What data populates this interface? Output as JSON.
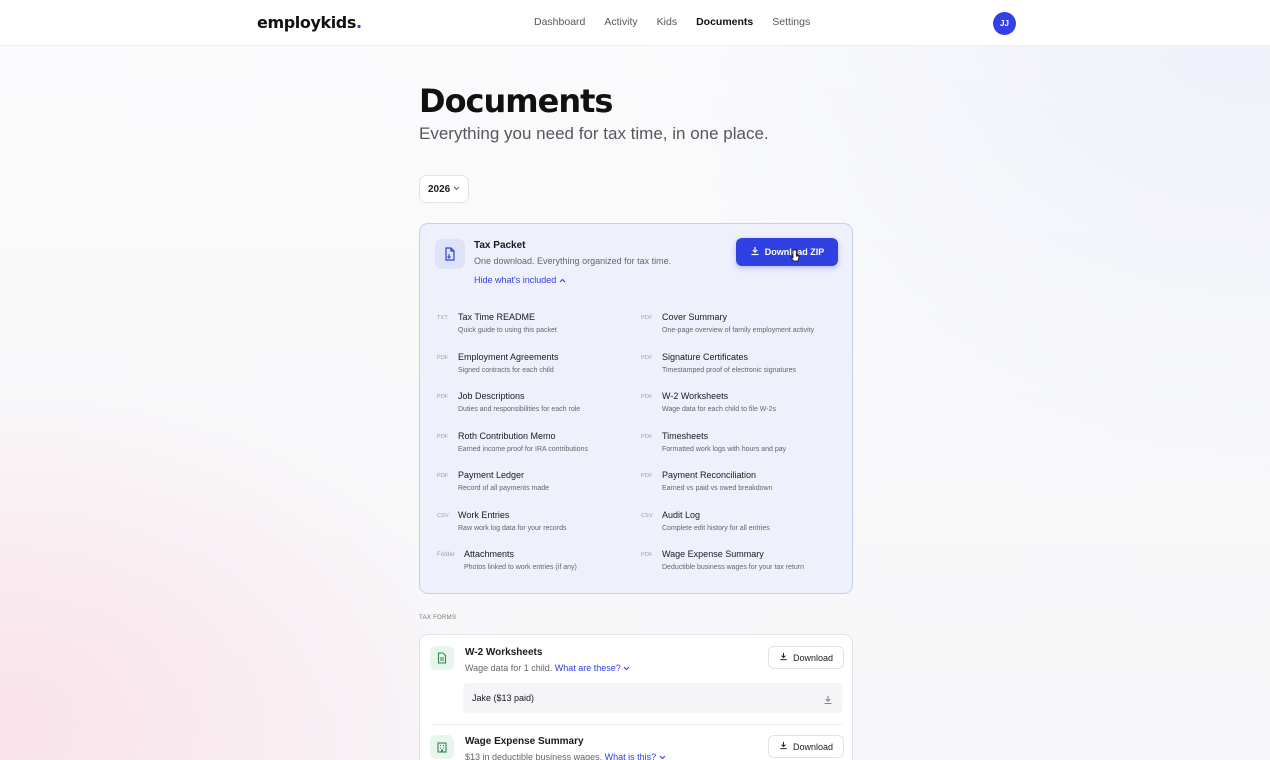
{
  "brand": {
    "name": "employkids",
    "dot": "."
  },
  "nav": {
    "items": [
      "Dashboard",
      "Activity",
      "Kids",
      "Documents",
      "Settings"
    ],
    "active": "Documents"
  },
  "user": {
    "initials": "JJ"
  },
  "page": {
    "title": "Documents",
    "subtitle": "Everything you need for tax time, in one place."
  },
  "year_select": {
    "value": "2026"
  },
  "packet": {
    "title": "Tax Packet",
    "description": "One download. Everything organized for tax time.",
    "toggle_label": "Hide what's included",
    "download_label": "Download ZIP",
    "files": [
      {
        "ext": "TXT",
        "name": "Tax Time README",
        "desc": "Quick guide to using this packet"
      },
      {
        "ext": "PDF",
        "name": "Cover Summary",
        "desc": "One-page overview of family employment activity"
      },
      {
        "ext": "PDF",
        "name": "Employment Agreements",
        "desc": "Signed contracts for each child"
      },
      {
        "ext": "PDF",
        "name": "Signature Certificates",
        "desc": "Timestamped proof of electronic signatures"
      },
      {
        "ext": "PDF",
        "name": "Job Descriptions",
        "desc": "Duties and responsibilities for each role"
      },
      {
        "ext": "PDF",
        "name": "W-2 Worksheets",
        "desc": "Wage data for each child to file W-2s"
      },
      {
        "ext": "PDF",
        "name": "Roth Contribution Memo",
        "desc": "Earned income proof for IRA contributions"
      },
      {
        "ext": "PDF",
        "name": "Timesheets",
        "desc": "Formatted work logs with hours and pay"
      },
      {
        "ext": "PDF",
        "name": "Payment Ledger",
        "desc": "Record of all payments made"
      },
      {
        "ext": "PDF",
        "name": "Payment Reconciliation",
        "desc": "Earned vs paid vs owed breakdown"
      },
      {
        "ext": "CSV",
        "name": "Work Entries",
        "desc": "Raw work log data for your records"
      },
      {
        "ext": "CSV",
        "name": "Audit Log",
        "desc": "Complete edit history for all entries"
      },
      {
        "ext": "Folder",
        "name": "Attachments",
        "desc": "Photos linked to work entries (if any)"
      },
      {
        "ext": "PDF",
        "name": "Wage Expense Summary",
        "desc": "Deductible business wages for your tax return"
      }
    ]
  },
  "tax_forms": {
    "section_label": "TAX FORMS",
    "w2": {
      "title": "W-2 Worksheets",
      "desc": "Wage data for 1 child.",
      "link": "What are these?",
      "download_label": "Download",
      "children": [
        {
          "label": "Jake ($13 paid)"
        }
      ]
    },
    "wage": {
      "title": "Wage Expense Summary",
      "desc": "$13 in deductible business wages.",
      "link": "What is this?",
      "download_label": "Download"
    }
  },
  "colors": {
    "accent": "#3140e0",
    "packet_bg": "#eef0fb",
    "form_icon_bg": "#e7f5ec",
    "form_icon": "#2e8a52"
  }
}
